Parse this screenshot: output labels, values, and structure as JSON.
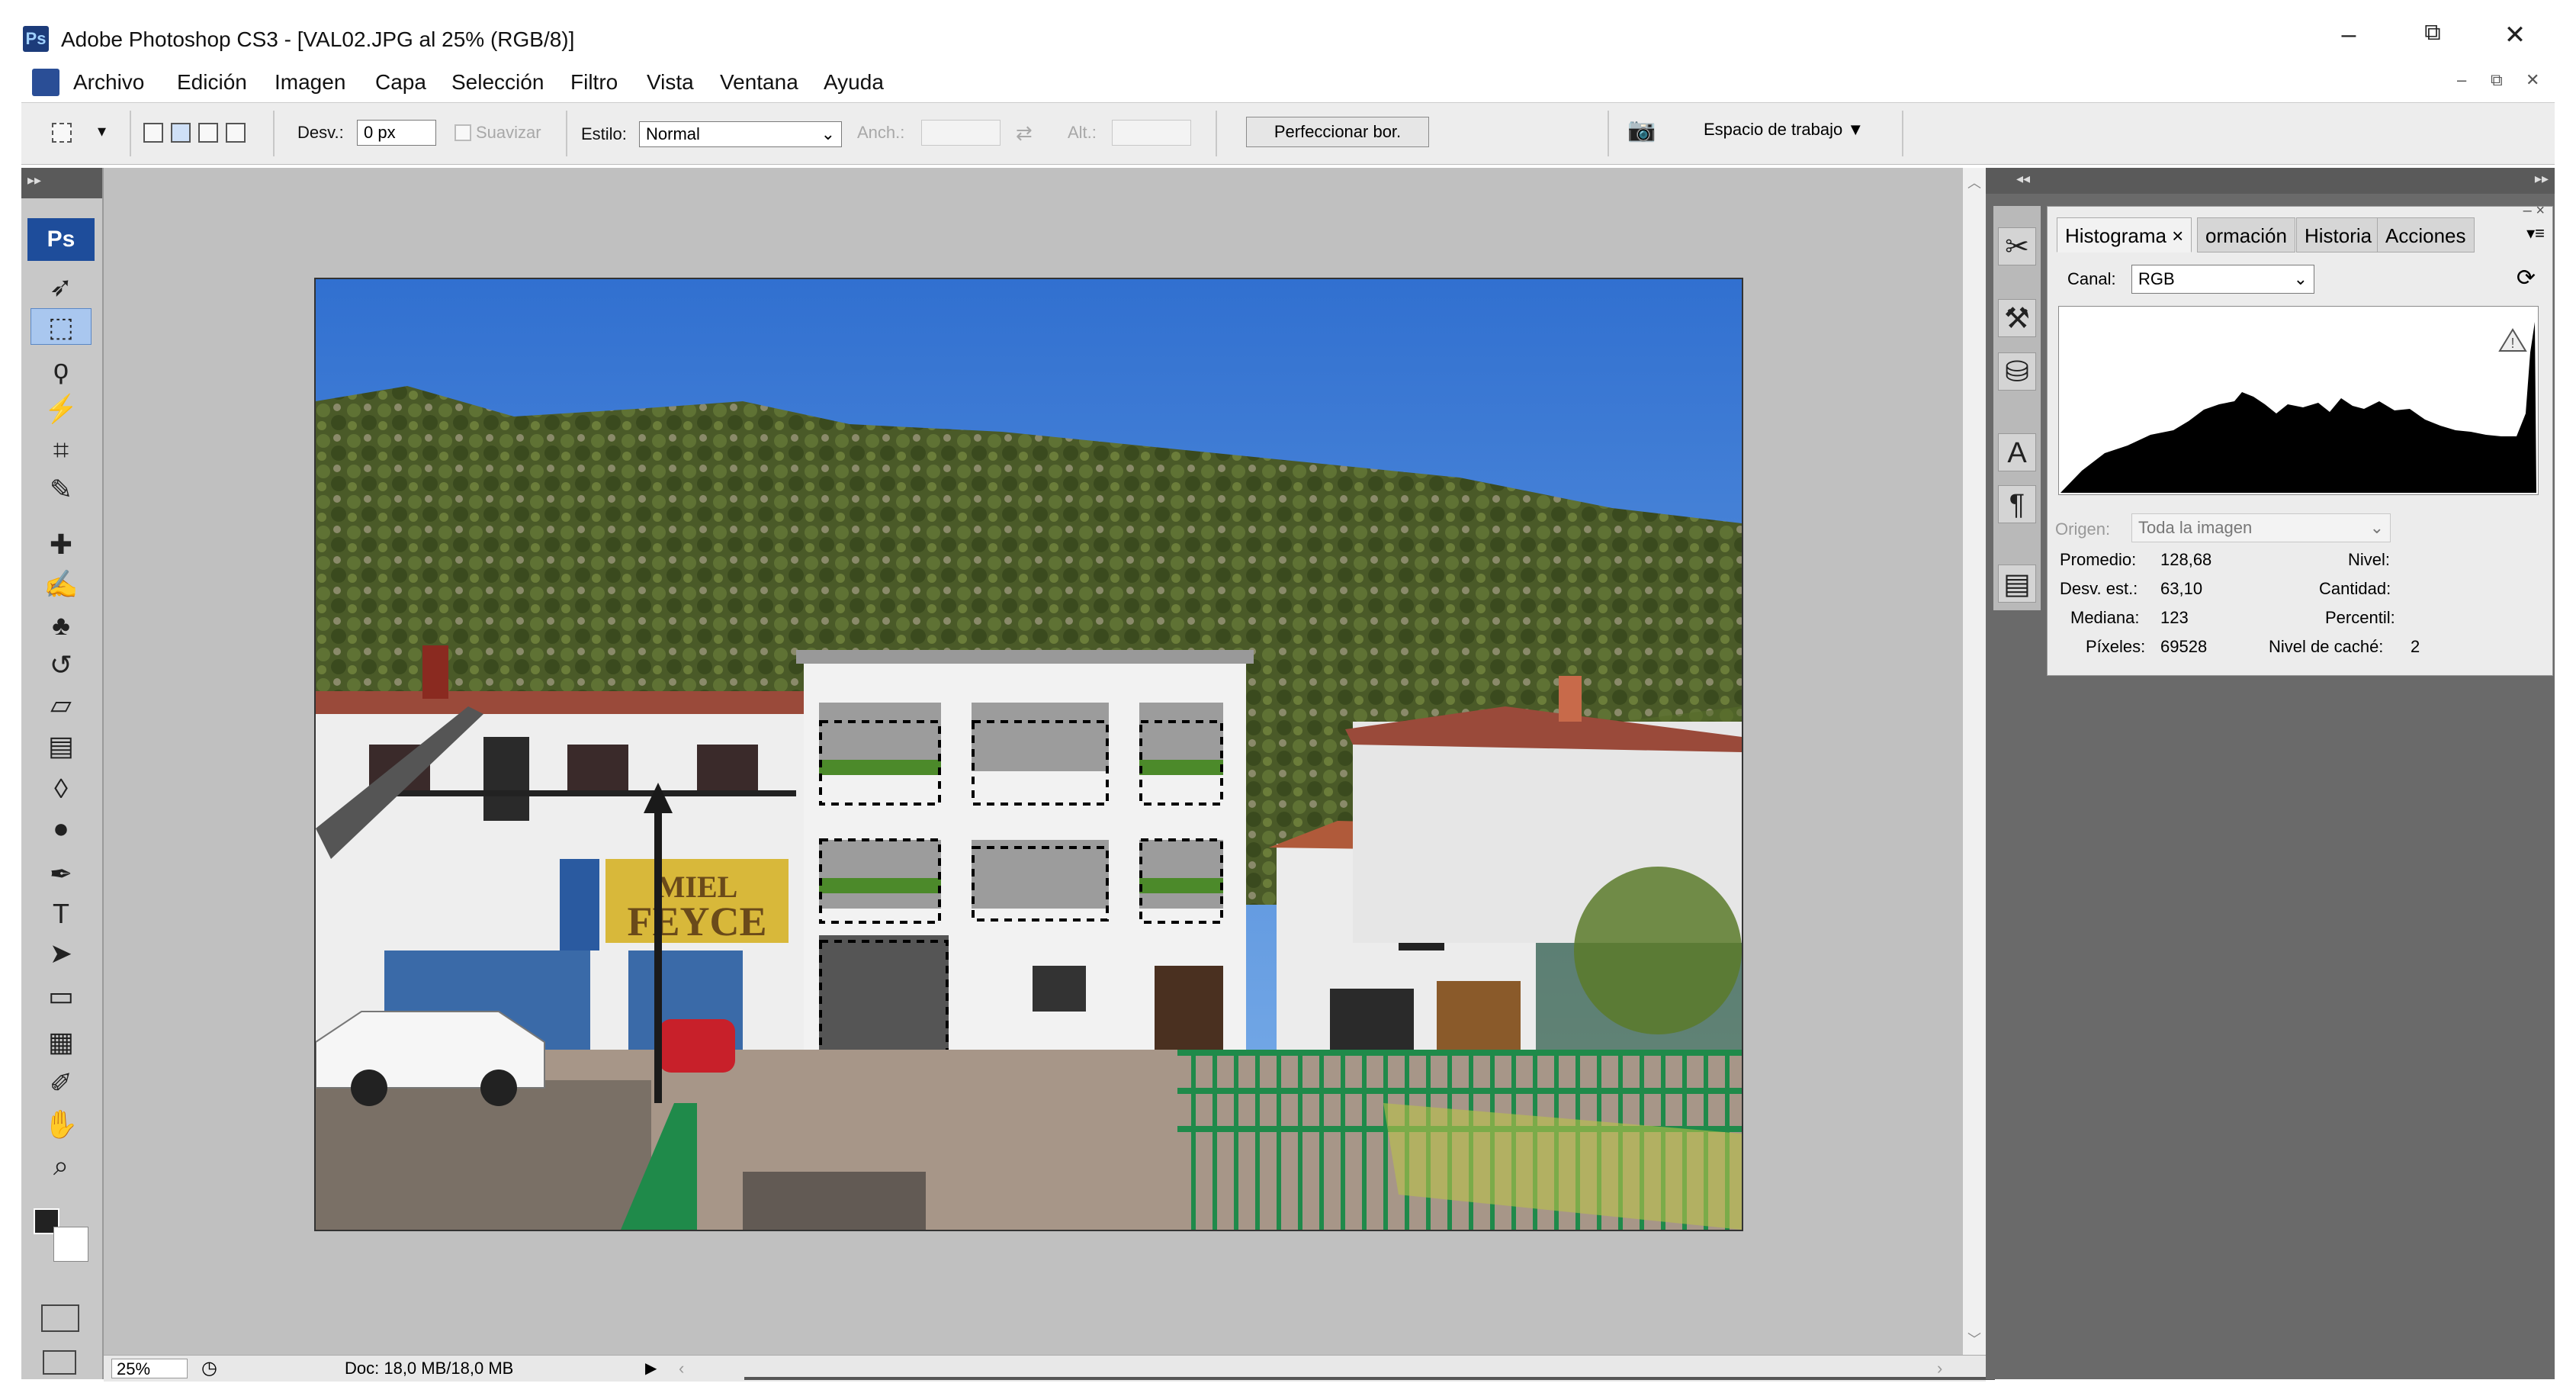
{
  "window": {
    "app_badge": "Ps",
    "title": "Adobe Photoshop CS3 - [VAL02.JPG al 25% (RGB/8)]",
    "controls": {
      "minimize": "–",
      "restore": "⧉",
      "close": "✕"
    }
  },
  "menu": {
    "items": [
      "Archivo",
      "Edición",
      "Imagen",
      "Capa",
      "Selección",
      "Filtro",
      "Vista",
      "Ventana",
      "Ayuda"
    ],
    "doc_controls": {
      "minimize": "–",
      "restore": "⧉",
      "close": "✕"
    }
  },
  "options_bar": {
    "feather_label": "Desv.:",
    "feather_value": "0 px",
    "antialias_label": "Suavizar",
    "style_label": "Estilo:",
    "style_value": "Normal",
    "width_label": "Anch.:",
    "height_label": "Alt.:",
    "refine_button": "Perfeccionar bor.",
    "workspace_label": "Espacio de trabajo ▼"
  },
  "toolbox": {
    "badge": "Ps",
    "tools": [
      {
        "name": "move-tool",
        "glyph": "➶"
      },
      {
        "name": "marquee-tool",
        "glyph": "⬚",
        "selected": true
      },
      {
        "name": "lasso-tool",
        "glyph": "ϙ"
      },
      {
        "name": "magic-wand-tool",
        "glyph": "⚡"
      },
      {
        "name": "crop-tool",
        "glyph": "⌗"
      },
      {
        "name": "slice-tool",
        "glyph": "✎"
      },
      {
        "name": "healing-brush-tool",
        "glyph": "✚"
      },
      {
        "name": "brush-tool",
        "glyph": "✍"
      },
      {
        "name": "clone-stamp-tool",
        "glyph": "♣"
      },
      {
        "name": "history-brush-tool",
        "glyph": "↺"
      },
      {
        "name": "eraser-tool",
        "glyph": "▱"
      },
      {
        "name": "gradient-tool",
        "glyph": "▤"
      },
      {
        "name": "blur-tool",
        "glyph": "◊"
      },
      {
        "name": "dodge-tool",
        "glyph": "●"
      },
      {
        "name": "pen-tool",
        "glyph": "✒"
      },
      {
        "name": "type-tool",
        "glyph": "T"
      },
      {
        "name": "path-selection-tool",
        "glyph": "➤"
      },
      {
        "name": "shape-tool",
        "glyph": "▭"
      },
      {
        "name": "notes-tool",
        "glyph": "▦"
      },
      {
        "name": "eyedropper-tool",
        "glyph": "✐"
      },
      {
        "name": "hand-tool",
        "glyph": "✋"
      },
      {
        "name": "zoom-tool",
        "glyph": "⌕"
      }
    ]
  },
  "status_bar": {
    "zoom": "25%",
    "doc_info": "Doc: 18,0 MB/18,0 MB"
  },
  "histogram_panel": {
    "tabs": [
      "Histograma ×",
      "ormación",
      "Historia",
      "Acciones"
    ],
    "channel_label": "Canal:",
    "channel_value": "RGB",
    "source_label": "Origen:",
    "source_value": "Toda la imagen",
    "stats": {
      "mean_label": "Promedio:",
      "mean_value": "128,68",
      "stddev_label": "Desv. est.:",
      "stddev_value": "63,10",
      "median_label": "Mediana:",
      "median_value": "123",
      "pixels_label": "Píxeles:",
      "pixels_value": "69528",
      "level_label": "Nivel:",
      "count_label": "Cantidad:",
      "percentile_label": "Percentil:",
      "cache_label": "Nivel de caché:",
      "cache_value": "2"
    }
  },
  "colors": {
    "sky": "#3f7ed6",
    "hill": "#4c5a2a",
    "railing": "#1f8a4a",
    "panel_bg": "#ececec",
    "dock_bg": "#6a6a6a"
  }
}
